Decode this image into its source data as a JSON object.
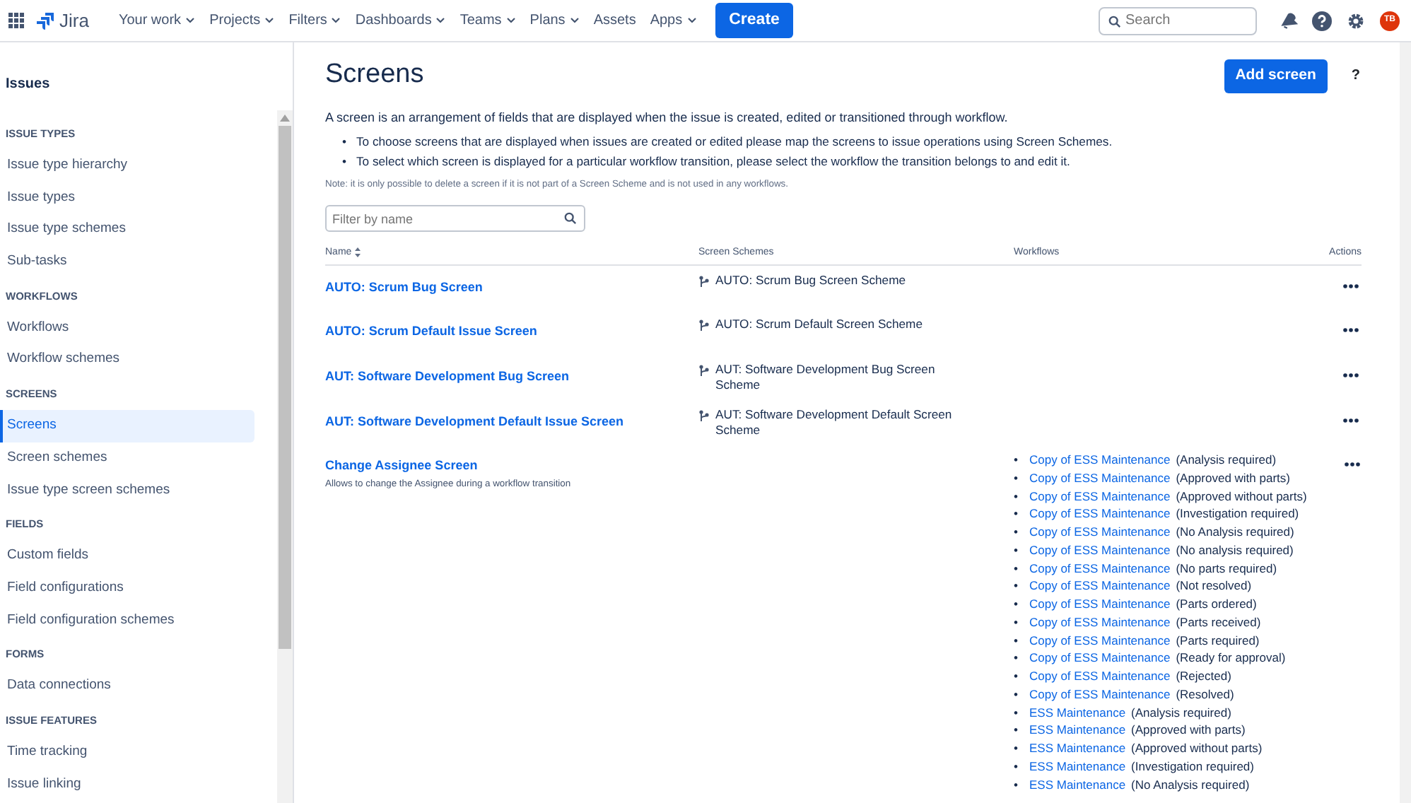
{
  "topnav": {
    "product": "Jira",
    "items": [
      {
        "label": "Your work",
        "dropdown": true
      },
      {
        "label": "Projects",
        "dropdown": true
      },
      {
        "label": "Filters",
        "dropdown": true
      },
      {
        "label": "Dashboards",
        "dropdown": true
      },
      {
        "label": "Teams",
        "dropdown": true
      },
      {
        "label": "Plans",
        "dropdown": true
      },
      {
        "label": "Assets",
        "dropdown": false
      },
      {
        "label": "Apps",
        "dropdown": true
      }
    ],
    "create_button": "Create",
    "search": {
      "placeholder": "Search"
    },
    "avatar": "TB"
  },
  "sidebar": {
    "title": "Issues",
    "sections": [
      {
        "heading": "ISSUE TYPES",
        "items": [
          {
            "label": "Issue type hierarchy",
            "selected": false
          },
          {
            "label": "Issue types",
            "selected": false
          },
          {
            "label": "Issue type schemes",
            "selected": false
          },
          {
            "label": "Sub-tasks",
            "selected": false
          }
        ]
      },
      {
        "heading": "WORKFLOWS",
        "items": [
          {
            "label": "Workflows",
            "selected": false
          },
          {
            "label": "Workflow schemes",
            "selected": false
          }
        ]
      },
      {
        "heading": "SCREENS",
        "items": [
          {
            "label": "Screens",
            "selected": true
          },
          {
            "label": "Screen schemes",
            "selected": false
          },
          {
            "label": "Issue type screen schemes",
            "selected": false
          }
        ]
      },
      {
        "heading": "FIELDS",
        "items": [
          {
            "label": "Custom fields",
            "selected": false
          },
          {
            "label": "Field configurations",
            "selected": false
          },
          {
            "label": "Field configuration schemes",
            "selected": false
          }
        ]
      },
      {
        "heading": "FORMS",
        "items": [
          {
            "label": "Data connections",
            "selected": false
          }
        ]
      },
      {
        "heading": "ISSUE FEATURES",
        "items": [
          {
            "label": "Time tracking",
            "selected": false
          },
          {
            "label": "Issue linking",
            "selected": false
          }
        ]
      }
    ]
  },
  "page": {
    "title": "Screens",
    "add_button": "Add screen",
    "help": "?",
    "intro": "A screen is an arrangement of fields that are displayed when the issue is created, edited or transitioned through workflow.",
    "bullets": [
      {
        "marker": "•",
        "before": "To choose screens that are displayed when issues are created or edited please map the screens to issue operations using ",
        "link": "Screen Schemes",
        "after": "."
      },
      {
        "marker": "•",
        "before": "To select which screen is displayed for a particular workflow transition, please select the ",
        "link": "workflow",
        "after": " the transition belongs to and edit it."
      }
    ],
    "note": "Note: it is only possible to delete a screen if it is not part of a Screen Scheme and is not used in any workflows.",
    "filter": {
      "placeholder": "Filter by name"
    },
    "table": {
      "columns": [
        "Name",
        "Screen Schemes",
        "Workflows",
        "Actions"
      ],
      "rows": [
        {
          "name": "AUTO: Scrum Bug Screen",
          "schemes": [
            "AUTO: Scrum Bug Screen Scheme"
          ],
          "workflows": []
        },
        {
          "name": "AUTO: Scrum Default Issue Screen",
          "schemes": [
            "AUTO: Scrum Default Screen Scheme"
          ],
          "workflows": []
        },
        {
          "name": "AUT: Software Development Bug Screen",
          "schemes": [
            "AUT: Software Development Bug Screen Scheme"
          ],
          "workflows": []
        },
        {
          "name": "AUT: Software Development Default Issue Screen",
          "schemes": [
            "AUT: Software Development Default Screen Scheme"
          ],
          "workflows": []
        },
        {
          "name": "Change Assignee Screen",
          "description": "Allows to change the Assignee during a workflow transition",
          "schemes": [],
          "workflows": [
            {
              "marker": "•",
              "link": "Copy of ESS Maintenance",
              "status": "(Analysis required)"
            },
            {
              "marker": "•",
              "link": "Copy of ESS Maintenance",
              "status": "(Approved with parts)"
            },
            {
              "marker": "•",
              "link": "Copy of ESS Maintenance",
              "status": "(Approved without parts)"
            },
            {
              "marker": "•",
              "link": "Copy of ESS Maintenance",
              "status": "(Investigation required)"
            },
            {
              "marker": "•",
              "link": "Copy of ESS Maintenance",
              "status": "(No Analysis required)"
            },
            {
              "marker": "•",
              "link": "Copy of ESS Maintenance",
              "status": "(No analysis required)"
            },
            {
              "marker": "•",
              "link": "Copy of ESS Maintenance",
              "status": "(No parts required)"
            },
            {
              "marker": "•",
              "link": "Copy of ESS Maintenance",
              "status": "(Not resolved)"
            },
            {
              "marker": "•",
              "link": "Copy of ESS Maintenance",
              "status": "(Parts ordered)"
            },
            {
              "marker": "•",
              "link": "Copy of ESS Maintenance",
              "status": "(Parts received)"
            },
            {
              "marker": "•",
              "link": "Copy of ESS Maintenance",
              "status": "(Parts required)"
            },
            {
              "marker": "•",
              "link": "Copy of ESS Maintenance",
              "status": "(Ready for approval)"
            },
            {
              "marker": "•",
              "link": "Copy of ESS Maintenance",
              "status": "(Rejected)"
            },
            {
              "marker": "•",
              "link": "Copy of ESS Maintenance",
              "status": "(Resolved)"
            },
            {
              "marker": "•",
              "link": "ESS Maintenance",
              "status": "(Analysis required)"
            },
            {
              "marker": "•",
              "link": "ESS Maintenance",
              "status": "(Approved with parts)"
            },
            {
              "marker": "•",
              "link": "ESS Maintenance",
              "status": "(Approved without parts)"
            },
            {
              "marker": "•",
              "link": "ESS Maintenance",
              "status": "(Investigation required)"
            },
            {
              "marker": "•",
              "link": "ESS Maintenance",
              "status": "(No Analysis required)"
            }
          ]
        }
      ]
    }
  }
}
